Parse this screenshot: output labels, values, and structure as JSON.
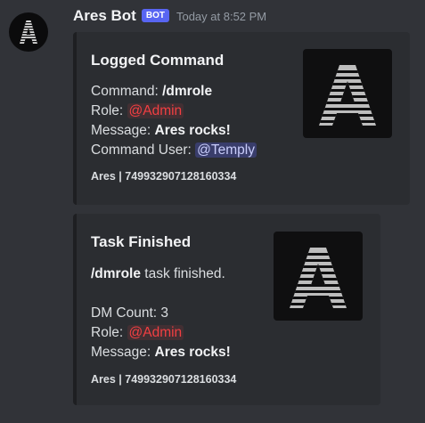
{
  "message": {
    "username": "Ares Bot",
    "bot_tag": "BOT",
    "timestamp": "Today at 8:52 PM",
    "avatar_icon": "ares-logo-icon"
  },
  "embeds": [
    {
      "title": "Logged Command",
      "lines": {
        "command_label": "Command: ",
        "command_value": "/dmrole",
        "role_label": "Role: ",
        "role_value": "@Admin",
        "message_label": "Message: ",
        "message_value": "Ares rocks!",
        "user_label": "Command User: ",
        "user_value": "@Temply"
      },
      "footer": "Ares | 749932907128160334",
      "thumbnail_icon": "ares-logo-icon"
    },
    {
      "title": "Task Finished",
      "lines": {
        "task_command": "/dmrole",
        "task_text": " task finished.",
        "count_label": "DM Count: ",
        "count_value": "3",
        "role_label": "Role: ",
        "role_value": "@Admin",
        "message_label": "Message: ",
        "message_value": "Ares rocks!"
      },
      "footer": "Ares | 749932907128160334",
      "thumbnail_icon": "ares-logo-icon"
    }
  ],
  "colors": {
    "background": "#313338",
    "embed_background": "#2b2d31",
    "embed_border": "#1e1f22",
    "bot_tag": "#5865f2",
    "role_mention": "#f23f42",
    "user_mention": "#c9cdfb"
  }
}
